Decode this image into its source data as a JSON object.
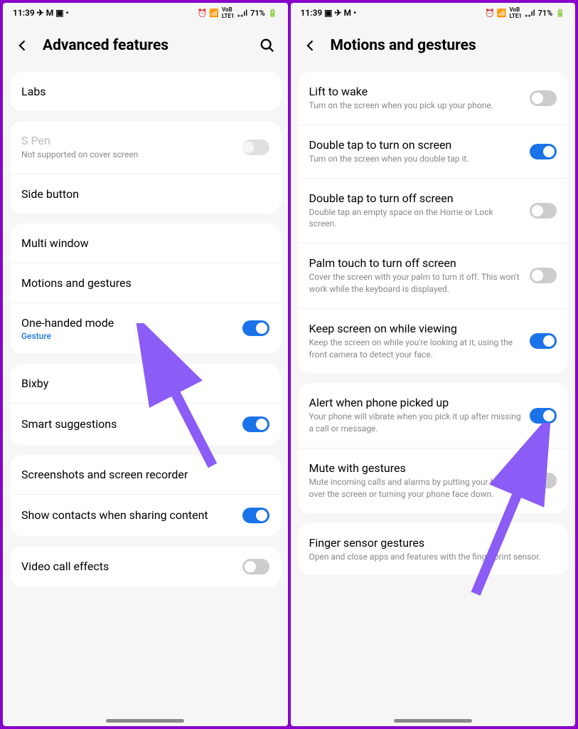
{
  "status": {
    "time": "11:39",
    "battery": "71%"
  },
  "left": {
    "title": "Advanced features",
    "groups": [
      {
        "items": [
          {
            "title": "Labs"
          }
        ]
      },
      {
        "items": [
          {
            "title": "S Pen",
            "sub": "Not supported on cover screen",
            "toggle": "disabled",
            "disabled": true
          },
          {
            "title": "Side button"
          }
        ]
      },
      {
        "items": [
          {
            "title": "Multi window"
          },
          {
            "title": "Motions and gestures"
          },
          {
            "title": "One-handed mode",
            "value": "Gesture",
            "toggle": "on"
          }
        ]
      },
      {
        "items": [
          {
            "title": "Bixby"
          },
          {
            "title": "Smart suggestions",
            "toggle": "on"
          }
        ]
      },
      {
        "items": [
          {
            "title": "Screenshots and screen recorder"
          },
          {
            "title": "Show contacts when sharing content",
            "toggle": "on"
          }
        ]
      },
      {
        "items": [
          {
            "title": "Video call effects",
            "toggle": "off"
          }
        ]
      }
    ]
  },
  "right": {
    "title": "Motions and gestures",
    "groups": [
      {
        "items": [
          {
            "title": "Lift to wake",
            "sub": "Turn on the screen when you pick up your phone.",
            "toggle": "off"
          },
          {
            "title": "Double tap to turn on screen",
            "sub": "Turn on the screen when you double tap it.",
            "toggle": "on"
          },
          {
            "title": "Double tap to turn off screen",
            "sub": "Double tap an empty space on the Home or Lock screen.",
            "toggle": "off"
          },
          {
            "title": "Palm touch to turn off screen",
            "sub": "Cover the screen with your palm to turn it off. This won't work while the keyboard is displayed.",
            "toggle": "off"
          },
          {
            "title": "Keep screen on while viewing",
            "sub": "Keep the screen on while you're looking at it, using the front camera to detect your face.",
            "toggle": "on"
          }
        ]
      },
      {
        "items": [
          {
            "title": "Alert when phone picked up",
            "sub": "Your phone will vibrate when you pick it up after missing a call or message.",
            "toggle": "on"
          },
          {
            "title": "Mute with gestures",
            "sub": "Mute incoming calls and alarms by putting your hand over the screen or turning your phone face down.",
            "toggle": "off"
          }
        ]
      },
      {
        "items": [
          {
            "title": "Finger sensor gestures",
            "sub": "Open and close apps and features with the fingerprint sensor."
          }
        ]
      }
    ]
  }
}
